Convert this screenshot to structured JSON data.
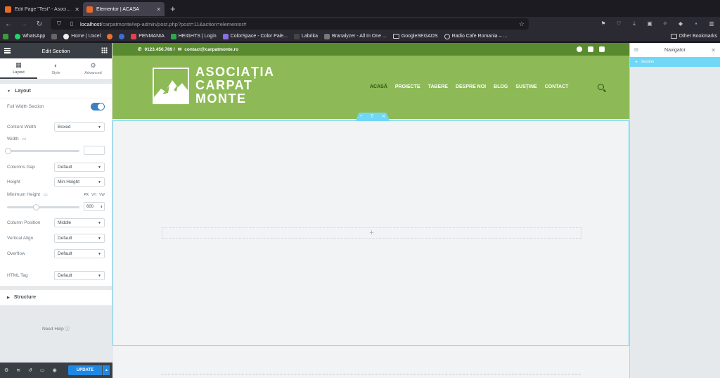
{
  "browser": {
    "tabs": [
      {
        "title": "Edit Page \"Test\" - Asociația C",
        "active": false
      },
      {
        "title": "Elementor | ACASĂ",
        "active": true
      }
    ],
    "url_host": "localhost",
    "url_path": "/carpatmonte/wp-admin/post.php?post=11&action=elementor#",
    "bookmarks": [
      "WhatsApp",
      "Home | Uxcel",
      "PENMANIA",
      "HEIGHTS | Login",
      "ColorSpace - Color Pale...",
      "Labrika",
      "Branalyzer - All In One ...",
      "GoogleSEGADS",
      "Radio Cafe Romania – ..."
    ],
    "other_bookmarks": "Other Bookmarks"
  },
  "panel": {
    "title": "Edit Section",
    "tabs": [
      "Layout",
      "Style",
      "Advanced"
    ],
    "section_layout": "Layout",
    "full_width_label": "Full Width Section",
    "content_width_label": "Content Width",
    "content_width_value": "Boxed",
    "width_label": "Width",
    "columns_gap_label": "Columns Gap",
    "columns_gap_value": "Default",
    "height_label": "Height",
    "height_value": "Min Height",
    "min_height_label": "Minimum Height",
    "units": [
      "PX",
      "VH",
      "VW"
    ],
    "min_height_value": "600",
    "min_height_fraction": 0.4,
    "column_position_label": "Column Position",
    "column_position_value": "Middle",
    "vertical_align_label": "Vertical Align",
    "vertical_align_value": "Default",
    "overflow_label": "Overflow",
    "overflow_value": "Default",
    "html_tag_label": "HTML Tag",
    "html_tag_value": "Default",
    "section_structure": "Structure",
    "need_help": "Need Help",
    "update": "UPDATE"
  },
  "site": {
    "phone": "0123.456.789 /",
    "email": "contact@carpatmonte.ro",
    "logo_lines": [
      "ASOCIAȚIA",
      "CARPAT",
      "MONTE"
    ],
    "menu": [
      "ACASĂ",
      "PROIECTE",
      "TABERE",
      "DESPRE NOI",
      "BLOG",
      "SUSȚINE",
      "CONTACT"
    ],
    "colors": {
      "topbar": "#5a8a2f",
      "header": "#8dba56",
      "active_menu": "#2d5216",
      "selection": "#71d7f7"
    }
  },
  "navigator": {
    "title": "Navigator",
    "item": "Section"
  }
}
